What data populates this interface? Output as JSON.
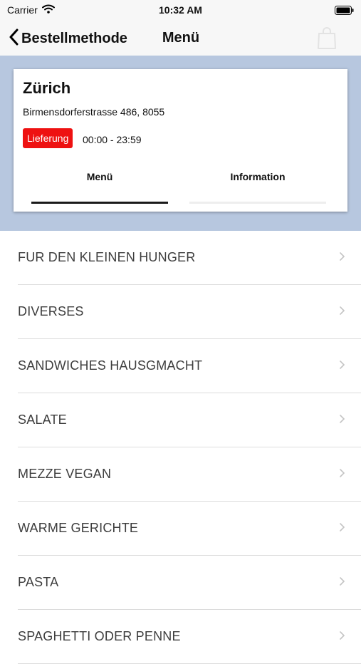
{
  "status_bar": {
    "carrier": "Carrier",
    "time": "10:32 AM"
  },
  "nav": {
    "back_label": "Bestellmethode",
    "title": "Menü"
  },
  "store": {
    "name": "Zürich",
    "address": "Birmensdorferstrasse 486, 8055",
    "badge": "Lieferung",
    "hours": "00:00 - 23:59"
  },
  "tabs": [
    {
      "label": "Menü",
      "active": true
    },
    {
      "label": "Information",
      "active": false
    }
  ],
  "categories": [
    "FUR DEN KLEINEN HUNGER",
    "DIVERSES",
    "SANDWICHES HAUSGMACHT",
    "SALATE",
    "MEZZE VEGAN",
    "WARME GERICHTE",
    "PASTA",
    "SPAGHETTI ODER PENNE"
  ],
  "colors": {
    "header_background": "#b7c7df",
    "badge": "#ee1111",
    "active_tab_underline": "#1a1a1a"
  },
  "icons": [
    "wifi-icon",
    "battery-icon",
    "chevron-left-icon",
    "shopping-bag-icon",
    "chevron-right-icon"
  ]
}
